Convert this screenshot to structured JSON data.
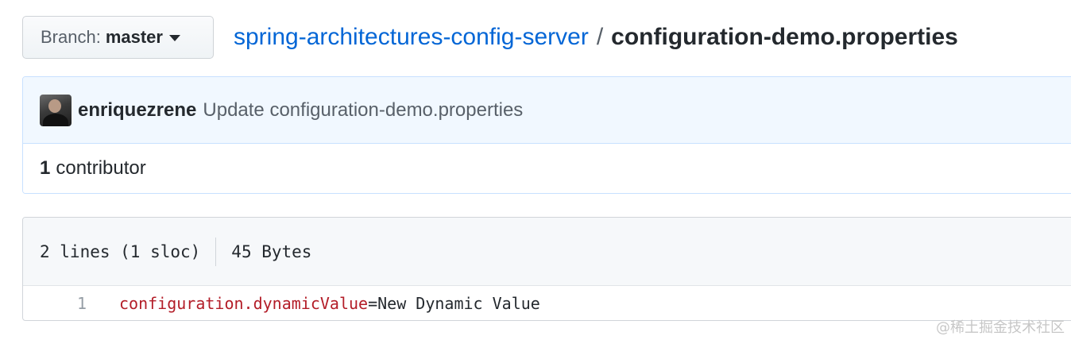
{
  "branch": {
    "prefix": "Branch:",
    "name": "master"
  },
  "breadcrumb": {
    "repo": "spring-architectures-config-server",
    "separator": "/",
    "file": "configuration-demo.properties"
  },
  "commit": {
    "author": "enriquezrene",
    "message": "Update configuration-demo.properties"
  },
  "contributors": {
    "count": "1",
    "label": "contributor"
  },
  "file": {
    "lines": "2 lines (1 sloc)",
    "size": "45 Bytes",
    "code": [
      {
        "num": "1",
        "key": "configuration.dynamicValue",
        "eq": "=",
        "value": "New Dynamic Value"
      }
    ]
  },
  "watermark": "@稀土掘金技术社区",
  "colors": {
    "link": "#0366d6",
    "commit_bg": "#f1f8ff",
    "commit_border": "#c8e1ff",
    "code_key": "#b31d28"
  },
  "icons": {
    "caret": "triangle-down-icon",
    "avatar": "user-avatar"
  }
}
